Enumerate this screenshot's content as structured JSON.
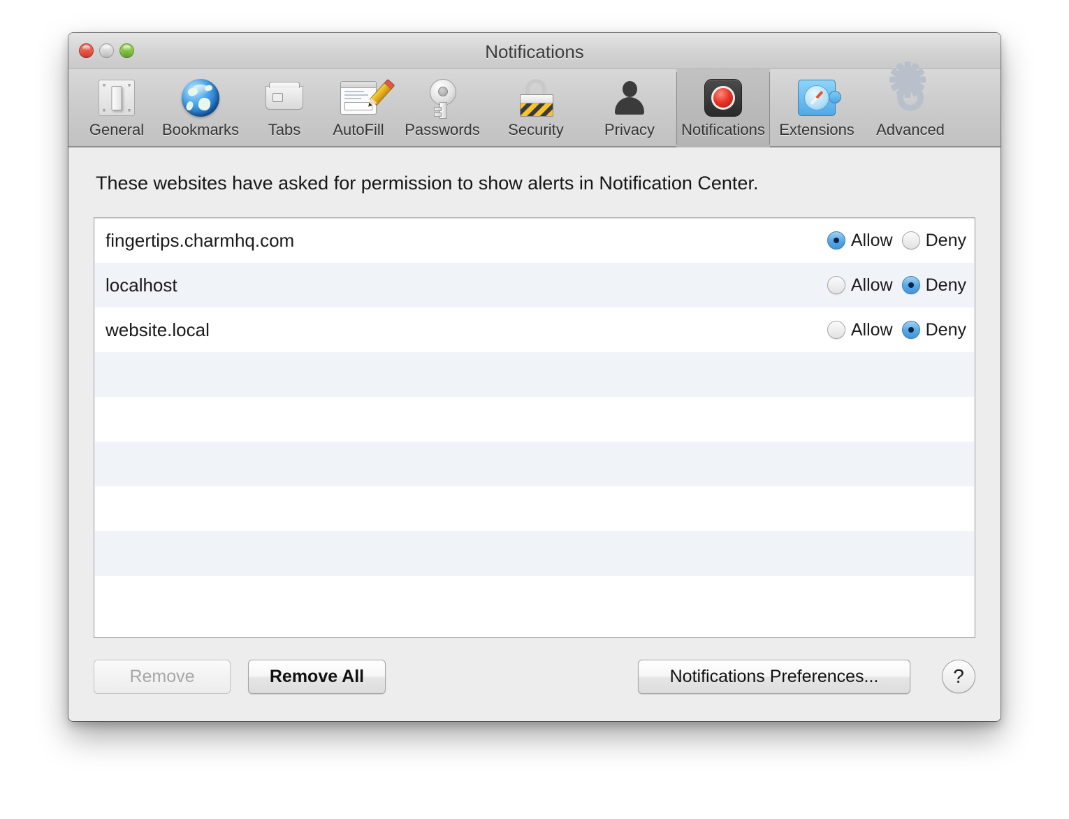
{
  "window": {
    "title": "Notifications",
    "traffic_lights": [
      "close",
      "minimize",
      "zoom"
    ]
  },
  "toolbar": {
    "items": [
      {
        "label": "General",
        "icon": "switch-icon",
        "selected": false
      },
      {
        "label": "Bookmarks",
        "icon": "globe-icon",
        "selected": false
      },
      {
        "label": "Tabs",
        "icon": "tabs-icon",
        "selected": false
      },
      {
        "label": "AutoFill",
        "icon": "form-pencil-icon",
        "selected": false
      },
      {
        "label": "Passwords",
        "icon": "key-icon",
        "selected": false
      },
      {
        "label": "Security",
        "icon": "padlock-icon",
        "selected": false
      },
      {
        "label": "Privacy",
        "icon": "person-icon",
        "selected": false
      },
      {
        "label": "Notifications",
        "icon": "notification-icon",
        "selected": true
      },
      {
        "label": "Extensions",
        "icon": "puzzle-compass-icon",
        "selected": false
      },
      {
        "label": "Advanced",
        "icon": "gear-icon",
        "selected": false
      }
    ]
  },
  "main": {
    "description": "These websites have asked for permission to show alerts in Notification Center.",
    "permission_options": {
      "allow": "Allow",
      "deny": "Deny"
    },
    "websites": [
      {
        "name": "fingertips.charmhq.com",
        "permission": "allow"
      },
      {
        "name": "localhost",
        "permission": "deny"
      },
      {
        "name": "website.local",
        "permission": "deny"
      }
    ],
    "empty_row_count": 6
  },
  "footer": {
    "remove_label": "Remove",
    "remove_enabled": false,
    "remove_all_label": "Remove All",
    "notifications_preferences_label": "Notifications Preferences...",
    "help_label": "?"
  },
  "colors": {
    "accent_blue": "#5ba9e6",
    "window_bg": "#ededed",
    "row_alt": "#f0f3f7",
    "notification_red": "#e83327"
  }
}
